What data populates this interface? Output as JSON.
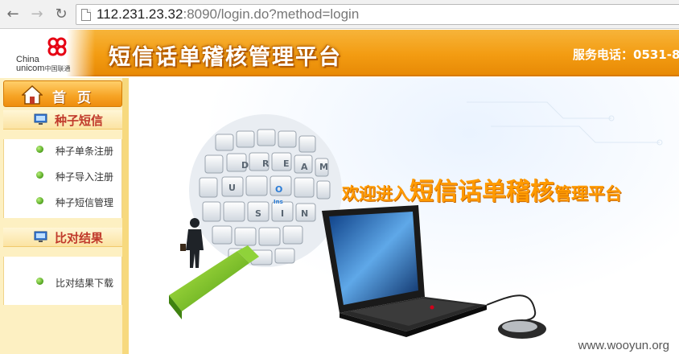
{
  "browser": {
    "url_host": "112.231.23.32",
    "url_rest": ":8090/login.do?method=login"
  },
  "header": {
    "logo_en_line1": "China",
    "logo_en_line2": "unicom",
    "logo_cn": "中国联通",
    "title": "短信话单稽核管理平台",
    "hotline": "服务电话：0531-8"
  },
  "sidebar": {
    "home_label": "首页",
    "sections": [
      {
        "title": "种子短信",
        "items": [
          "种子单条注册",
          "种子导入注册",
          "种子短信管理"
        ]
      },
      {
        "title": "比对结果",
        "items": [
          "比对结果下载"
        ]
      }
    ]
  },
  "main": {
    "welcome_part1": "欢迎进入",
    "welcome_part2": "短信话单稽核",
    "welcome_part3": "管理平台",
    "keyboard_keys": [
      "D",
      "R",
      "E",
      "A",
      "M",
      "U",
      "S",
      "I",
      "N",
      "O",
      "Ins"
    ]
  },
  "watermark": "www.wooyun.org",
  "colors": {
    "header_orange": "#f39c12",
    "sidebar_bg": "#fdf0c2",
    "section_title_red": "#c0392b",
    "welcome_orange": "#ff9a00"
  }
}
